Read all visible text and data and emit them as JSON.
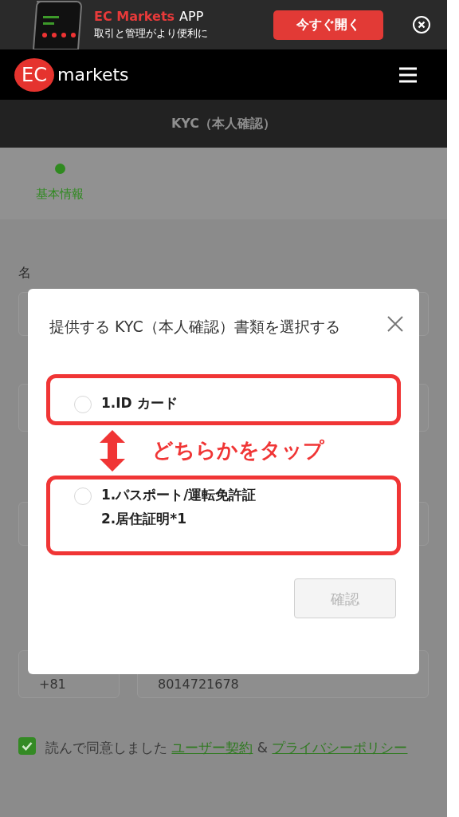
{
  "banner": {
    "brand": "EC Markets",
    "suffix": "APP",
    "subtitle": "取引と管理がより便利に",
    "button": "今すぐ開く"
  },
  "header": {
    "logo_mark": "EC",
    "logo_text": "markets"
  },
  "page_title": "KYC（本人確認）",
  "steps": [
    {
      "label": "基本情報",
      "selected": true
    }
  ],
  "form": {
    "first_name_label": "名",
    "phone_code": "+81",
    "phone_number": "8014721678"
  },
  "agreement": {
    "checked": true,
    "text": "読んで同意しました",
    "link1": "ユーザー契約",
    "joiner": "&",
    "link2": "プライバシーポリシー"
  },
  "modal": {
    "title": "提供する KYC（本人確認）書類を選択する",
    "options": [
      {
        "lines": [
          "1.ID カード"
        ],
        "selected": false
      },
      {
        "lines": [
          "1.パスポート/運転免許証",
          "2.居住証明*1"
        ],
        "selected": false
      }
    ],
    "confirm": "確認",
    "confirm_disabled": true
  },
  "annotation": {
    "text": "どちらかをタップ"
  }
}
